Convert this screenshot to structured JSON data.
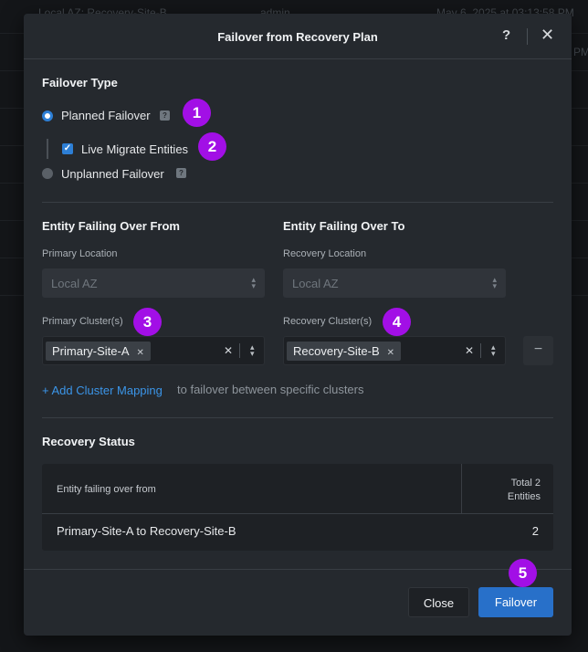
{
  "background": {
    "row_text": [
      "Local AZ: Recovery-Site-B",
      "admin",
      "May 6, 2025 at 03:13:58 PM",
      "PM"
    ]
  },
  "modal": {
    "title": "Failover from Recovery Plan",
    "help_icon": "question-mark-icon",
    "close_icon": "close-icon",
    "close_glyph": "✕",
    "help_glyph": "?"
  },
  "failover_type": {
    "title": "Failover Type",
    "options": [
      {
        "label": "Planned Failover",
        "selected": true
      },
      {
        "label": "Unplanned Failover",
        "selected": false
      }
    ],
    "live_migrate": {
      "label": "Live Migrate Entities",
      "checked": true
    }
  },
  "from": {
    "title": "Entity Failing Over From",
    "location_label": "Primary Location",
    "location_value": "Local AZ",
    "cluster_label": "Primary Cluster(s)",
    "cluster_chip": "Primary-Site-A"
  },
  "to": {
    "title": "Entity Failing Over To",
    "location_label": "Recovery Location",
    "location_value": "Local AZ",
    "cluster_label": "Recovery Cluster(s)",
    "cluster_chip": "Recovery-Site-B"
  },
  "mapping": {
    "link": "+ Add Cluster Mapping",
    "hint": "to failover between specific clusters"
  },
  "recovery_status": {
    "title": "Recovery Status",
    "col_left": "Entity failing over from",
    "col_right_line1": "Total 2",
    "col_right_line2": "Entities",
    "row_left": "Primary-Site-A to Recovery-Site-B",
    "row_right": "2"
  },
  "footer": {
    "close_label": "Close",
    "failover_label": "Failover"
  },
  "callouts": [
    "1",
    "2",
    "3",
    "4",
    "5"
  ],
  "colors": {
    "accent": "#2d7fd6",
    "callout": "#a20fe6",
    "link": "#3b95e8",
    "primary_button": "#2870c9"
  }
}
